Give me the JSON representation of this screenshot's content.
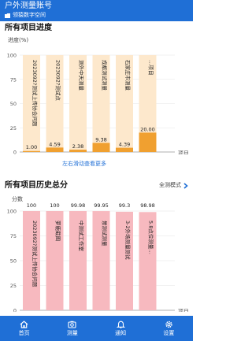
{
  "header": {
    "title": "户外测量账号",
    "subtitle": "领猿数字空间"
  },
  "progress_section": {
    "title": "所有项目进度",
    "y_unit": "进度(%)",
    "x_label": "项目",
    "scroll_hint": "左右滑动查看更多"
  },
  "history_section": {
    "title": "所有项目历史总分",
    "y_unit": "分数",
    "x_label": "项目",
    "mode_label": "全测模式"
  },
  "chart_data": [
    {
      "type": "bar",
      "title": "所有项目进度",
      "ylabel": "进度(%)",
      "xlabel": "项目",
      "ylim": [
        0,
        100
      ],
      "yticks": [
        0,
        25,
        50,
        75,
        100
      ],
      "grid": true,
      "categories": [
        "2023092?测试上传协会问题",
        "2023092?测试点",
        "测外中天测量",
        "成都测试测量",
        "石家庄市测量",
        "…项目"
      ],
      "values": [
        1.0,
        4.59,
        2.38,
        9.38,
        4.39,
        20.0
      ],
      "value_labels": [
        "1.00",
        "4.59",
        "2.38",
        "9.38",
        "4.39",
        "20.00"
      ],
      "colors": {
        "bar": "#f0a030",
        "track": "#fde8cc"
      }
    },
    {
      "type": "bar",
      "title": "所有项目历史总分",
      "ylabel": "分数",
      "xlabel": "项目",
      "ylim": [
        0,
        100
      ],
      "yticks": [
        0,
        25,
        50,
        75,
        100
      ],
      "grid": true,
      "categories": [
        "2023092?测试上传协会问题",
        "萝鹿截图",
        "中测试工作室",
        "景测试测量",
        "3-2外场测量测试",
        "5.8点位测量…"
      ],
      "values": [
        100,
        100,
        99.98,
        99.95,
        99.3,
        98.98
      ],
      "value_labels": [
        "100",
        "100",
        "99.98",
        "99.95",
        "99.3",
        "98.98"
      ],
      "colors": {
        "bar": "#f7b9bf"
      }
    }
  ],
  "tabbar": [
    {
      "label": "首页",
      "icon": "home-icon"
    },
    {
      "label": "测量",
      "icon": "camera-icon"
    },
    {
      "label": "通知",
      "icon": "bell-icon"
    },
    {
      "label": "设置",
      "icon": "gear-icon"
    }
  ],
  "colors": {
    "primary": "#1f6fd6",
    "progress_bar": "#f0a030",
    "progress_track": "#fde8cc",
    "score_bar": "#f7b9bf"
  }
}
